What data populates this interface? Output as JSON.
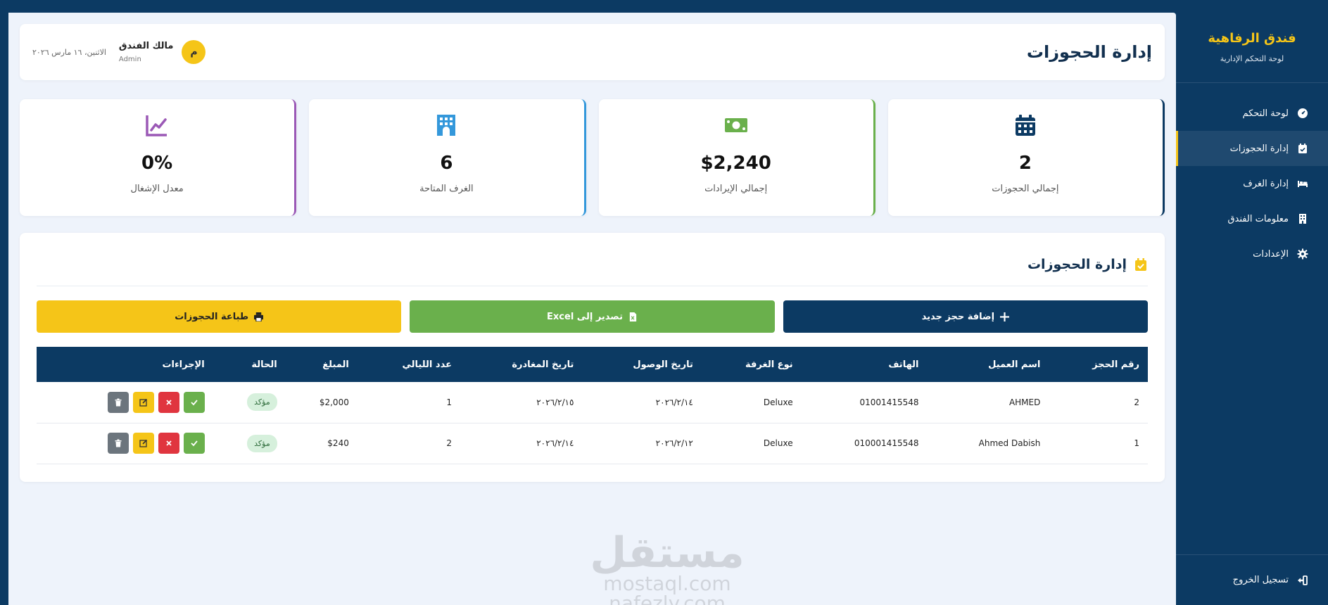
{
  "sidebar": {
    "brand_name": "فندق الرفاهية",
    "brand_subtitle": "لوحة التحكم الإدارية",
    "items": [
      {
        "label": "لوحة التحكم",
        "icon": "dashboard-icon",
        "active": false
      },
      {
        "label": "إدارة الحجوزات",
        "icon": "calendar-check-icon",
        "active": true
      },
      {
        "label": "إدارة الغرف",
        "icon": "bed-icon",
        "active": false
      },
      {
        "label": "معلومات الفندق",
        "icon": "building-icon",
        "active": false
      },
      {
        "label": "الإعدادات",
        "icon": "gear-icon",
        "active": false
      }
    ],
    "logout_label": "تسجيل الخروج"
  },
  "header": {
    "title": "إدارة الحجوزات",
    "user_name": "مالك الفندق",
    "user_role": "Admin",
    "avatar_letter": "م",
    "date": "الاثنين، ١٦ مارس ٢٠٢٦"
  },
  "stats": [
    {
      "value": "2",
      "label": "إجمالي الحجوزات",
      "icon": "calendar-icon",
      "color": "#0c3a63"
    },
    {
      "value": "$2,240",
      "label": "إجمالي الإيرادات",
      "icon": "money-icon",
      "color": "#6ab04c"
    },
    {
      "value": "6",
      "label": "الغرف المتاحة",
      "icon": "hotel-building-icon",
      "color": "#3498db"
    },
    {
      "value": "0%",
      "label": "معدل الإشغال",
      "icon": "chart-line-icon",
      "color": "#9b59b6"
    }
  ],
  "bookings": {
    "section_title": "إدارة الحجوزات",
    "buttons": {
      "add": "إضافة حجز جديد",
      "export": "تصدير إلى Excel",
      "print": "طباعة الحجوزات"
    },
    "columns": [
      "رقم الحجز",
      "اسم العميل",
      "الهاتف",
      "نوع الغرفة",
      "تاريخ الوصول",
      "تاريخ المغادرة",
      "عدد الليالي",
      "المبلغ",
      "الحالة",
      "الإجراءات"
    ],
    "rows": [
      {
        "id": "2",
        "customer": "AHMED",
        "phone": "01001415548",
        "room_type": "Deluxe",
        "arrival": "٢٠٢٦/٢/١٤",
        "departure": "٢٠٢٦/٢/١٥",
        "nights": "1",
        "amount": "$2,000",
        "status": "مؤكد"
      },
      {
        "id": "1",
        "customer": "Ahmed Dabish",
        "phone": "010001415548",
        "room_type": "Deluxe",
        "arrival": "٢٠٢٦/٢/١٢",
        "departure": "٢٠٢٦/٢/١٤",
        "nights": "2",
        "amount": "$240",
        "status": "مؤكد"
      }
    ]
  },
  "watermark": {
    "mark": "مستقل",
    "line1": "mostaql.com",
    "line2": "nafezly.com"
  },
  "colors": {
    "primary": "#0c3a63",
    "accent": "#f5c518",
    "success": "#6ab04c",
    "danger": "#e0353f",
    "info": "#3498db",
    "purple": "#9b59b6",
    "background": "#eef3fb"
  }
}
